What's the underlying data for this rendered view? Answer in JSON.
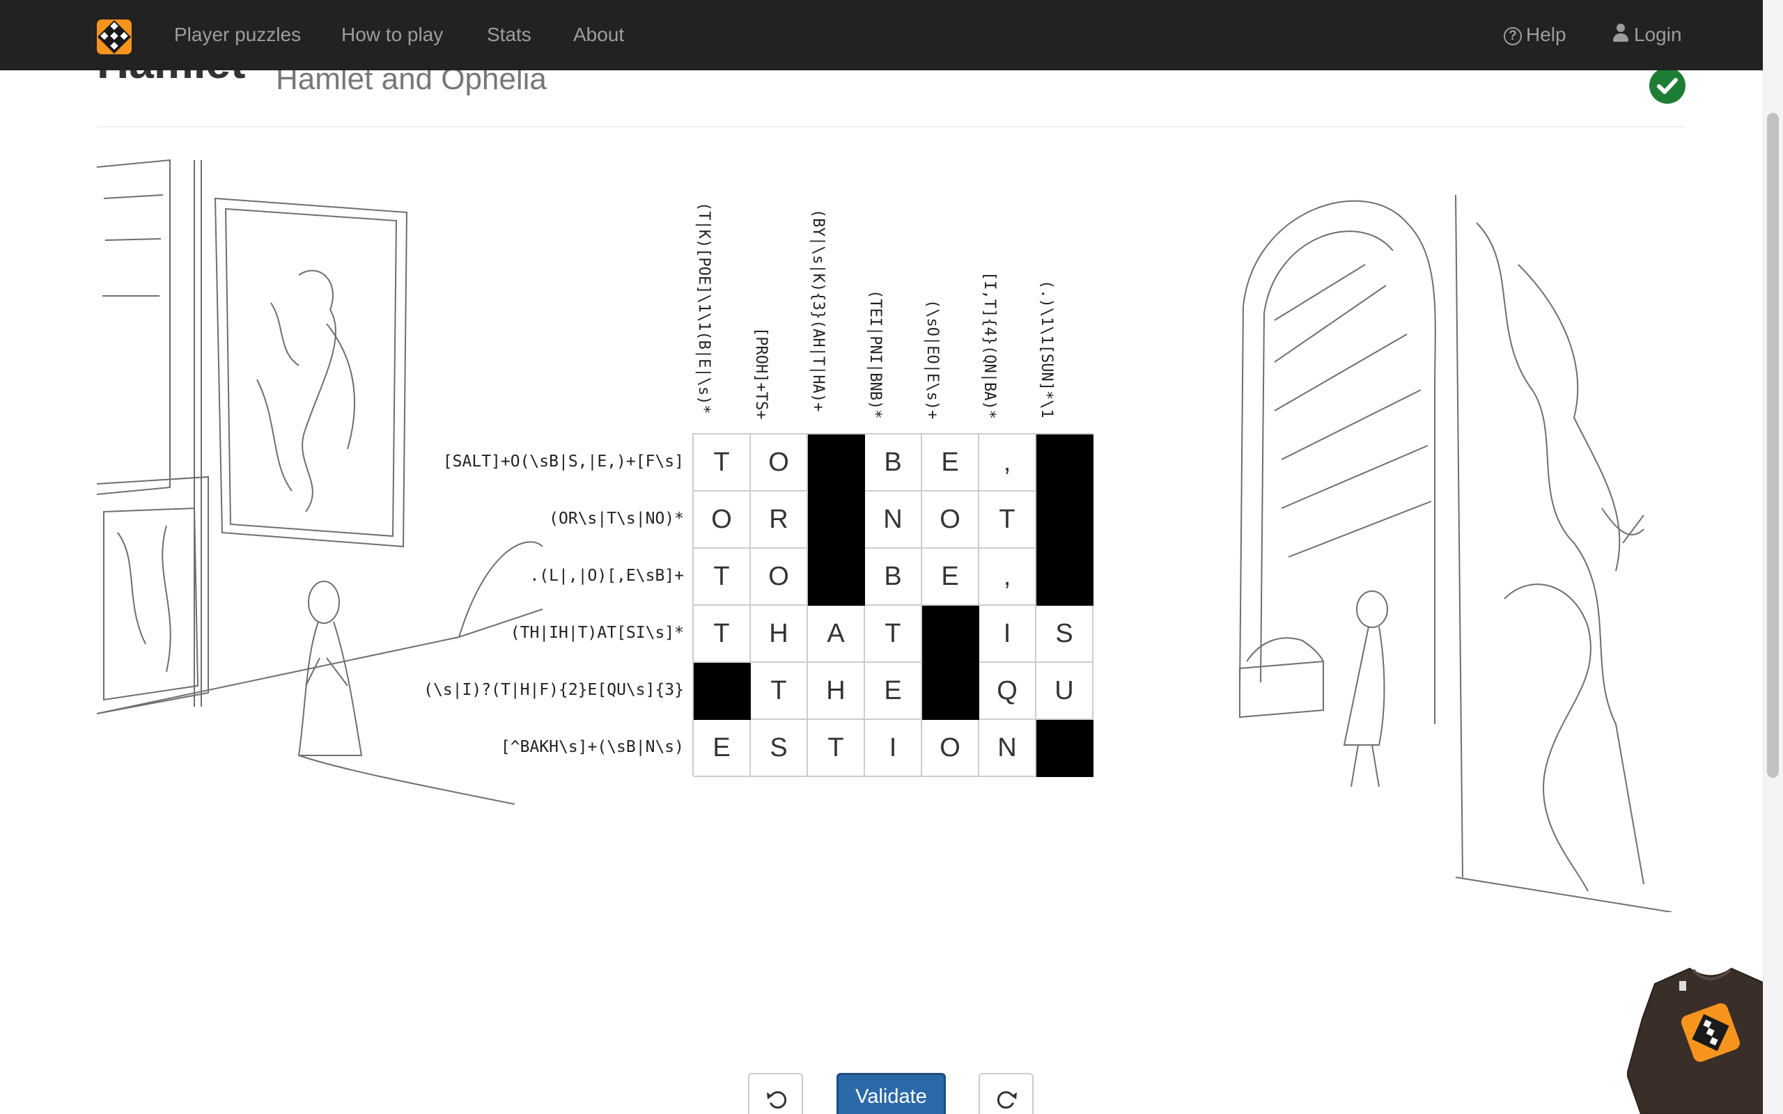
{
  "navbar": {
    "items": [
      {
        "label": "Player puzzles"
      },
      {
        "label": "How to play"
      },
      {
        "label": "Stats"
      },
      {
        "label": "About"
      }
    ],
    "help_label": "Help",
    "login_label": "Login"
  },
  "header": {
    "title": "Hamlet",
    "subtitle": "Hamlet and Ophelia",
    "solved_icon": "check-circle-icon"
  },
  "puzzle": {
    "column_clues": [
      "(T|K)[POE]\\1\\1(B|E|\\s)*",
      "[PROH]+TS+",
      "(BY|\\s|K){3}(AH|T|HA)+",
      "(TEI|PNI|BNB)*",
      "(\\sO|EO|E\\s)+",
      "[I,T]{4}(QN|BA)*",
      "(.)\\1\\1[SUN]*\\1"
    ],
    "row_clues": [
      "[SALT]+O(\\sB|S,|E,)+[F\\s]",
      "(OR\\s|T\\s|NO)*",
      ".(L|,|O)[,E\\sB]+",
      "(TH|IH|T)AT[SI\\s]*",
      "(\\s|I)?(T|H|F){2}E[QU\\s]{3}",
      "[^BAKH\\s]+(\\sB|N\\s)"
    ],
    "grid": [
      [
        "T",
        "O",
        "#",
        "B",
        "E",
        ",",
        "#"
      ],
      [
        "O",
        "R",
        "#",
        "N",
        "O",
        "T",
        "#"
      ],
      [
        "T",
        "O",
        "#",
        "B",
        "E",
        ",",
        "#"
      ],
      [
        "T",
        "H",
        "A",
        "T",
        "#",
        "I",
        "S"
      ],
      [
        "#",
        "T",
        "H",
        "E",
        "#",
        "Q",
        "U"
      ],
      [
        "E",
        "S",
        "T",
        "I",
        "O",
        "N",
        "#"
      ]
    ]
  },
  "controls": {
    "undo_icon": "undo-icon",
    "validate_label": "Validate",
    "redo_icon": "redo-icon"
  },
  "colors": {
    "navbar_bg": "#222222",
    "brand_orange": "#f7941d",
    "primary_button": "#2b6aa8",
    "solved_green": "#1e7d35",
    "blocked_cell": "#000000"
  }
}
